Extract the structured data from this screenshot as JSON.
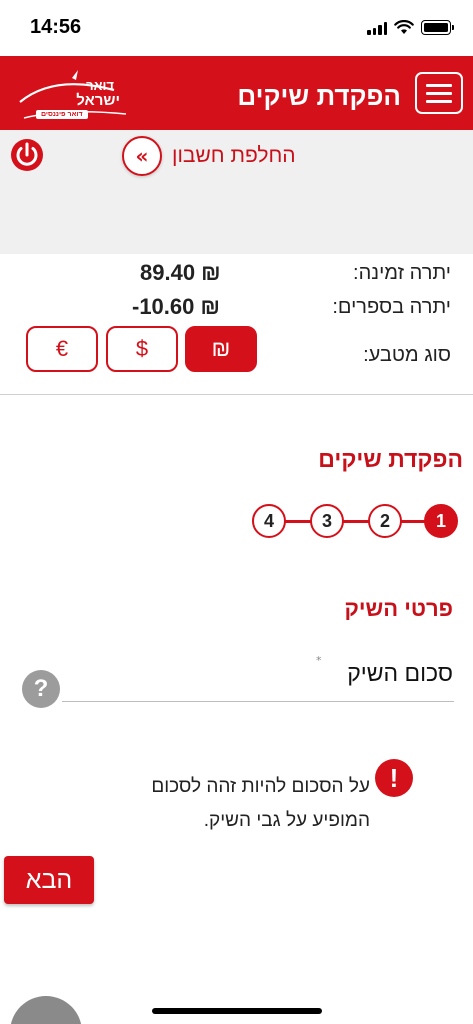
{
  "status": {
    "time": "14:56"
  },
  "header": {
    "title": "הפקדת שיקים",
    "logo_line1": "דואר",
    "logo_line2": "ישראל",
    "logo_tag": "דואר פיננסים"
  },
  "account": {
    "switch_label": "החלפת חשבון",
    "switch_chevron": "«"
  },
  "balances": {
    "available_label": "יתרה זמינה:",
    "available_value": "89.40 ₪",
    "books_label": "יתרה בספרים:",
    "books_value": "-10.60 ₪",
    "currency_label": "סוג מטבע:",
    "currencies": [
      "₪",
      "$",
      "€"
    ],
    "selected_currency": "₪"
  },
  "page": {
    "section_title": "הפקדת שיקים",
    "steps": [
      "1",
      "2",
      "3",
      "4"
    ],
    "current_step": "1",
    "sub_title": "פרטי השיק",
    "amount_label": "סכום השיק",
    "required_mark": "*",
    "help_glyph": "?",
    "warning_glyph": "!",
    "warning_text": "על הסכום להיות זהה לסכום המופיע על גבי השיק.",
    "next_label": "הבא"
  },
  "colors": {
    "brand": "#d4111a",
    "banner": "#f0f0f0",
    "help": "#9c9c9c"
  },
  "icons": [
    "signal-icon",
    "wifi-icon",
    "battery-icon",
    "menu-icon",
    "power-icon",
    "chevron-double-left-icon",
    "help-icon",
    "warning-icon"
  ]
}
